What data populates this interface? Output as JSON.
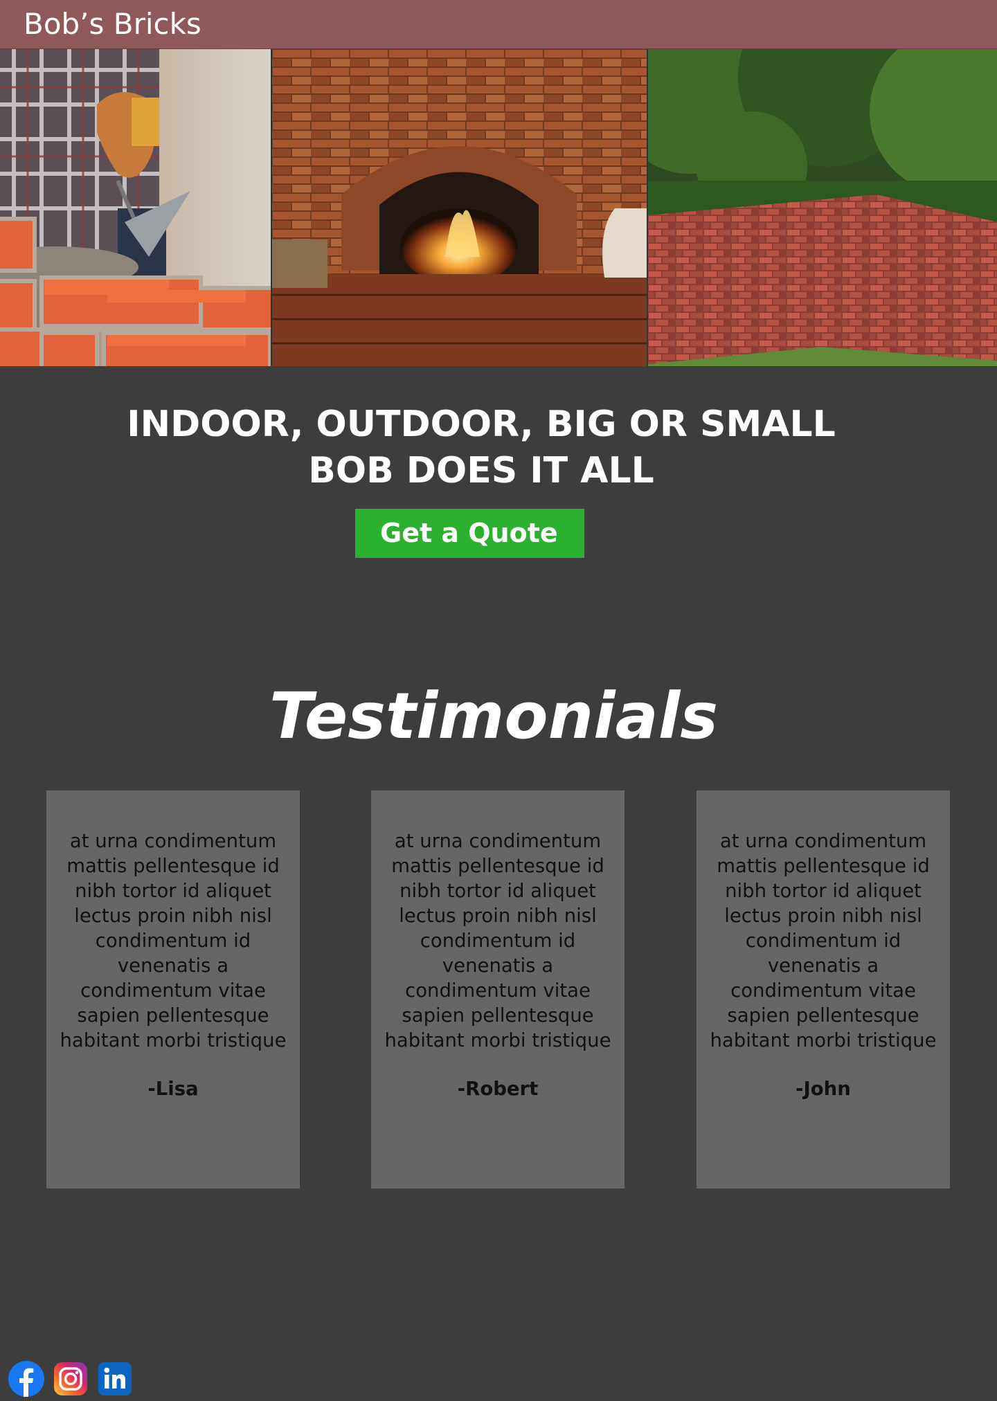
{
  "header": {
    "brand": "Bob’s Bricks"
  },
  "hero": {
    "images": [
      {
        "alt": "bricklayer-photo"
      },
      {
        "alt": "brick-fireplace-photo"
      },
      {
        "alt": "brick-patio-photo"
      }
    ],
    "headline_line1": "INDOOR, OUTDOOR, BIG OR SMALL",
    "headline_line2": "BOB DOES IT ALL",
    "cta_label": "Get a Quote",
    "cta_color": "#2cb02f"
  },
  "testimonials": {
    "title": "Testimonials",
    "items": [
      {
        "text": "at urna condimentum mattis pellentesque id nibh tortor id aliquet lectus proin nibh nisl condimentum id venenatis a condimentum vitae sapien pellentesque habitant morbi tristique",
        "author": "-Lisa"
      },
      {
        "text": "at urna condimentum mattis pellentesque id nibh tortor id aliquet lectus proin nibh nisl condimentum id venenatis a condimentum vitae sapien pellentesque habitant morbi tristique",
        "author": "-Robert"
      },
      {
        "text": "at urna condimentum mattis pellentesque id nibh tortor id aliquet lectus proin nibh nisl condimentum id venenatis a condimentum vitae sapien pellentesque habitant morbi tristique",
        "author": "-John"
      }
    ]
  },
  "footer": {
    "socials": [
      "facebook-icon",
      "instagram-icon",
      "linkedin-icon"
    ]
  },
  "colors": {
    "header_bg": "#8f585a",
    "page_bg": "#3d3d3d",
    "card_bg": "#666666"
  }
}
